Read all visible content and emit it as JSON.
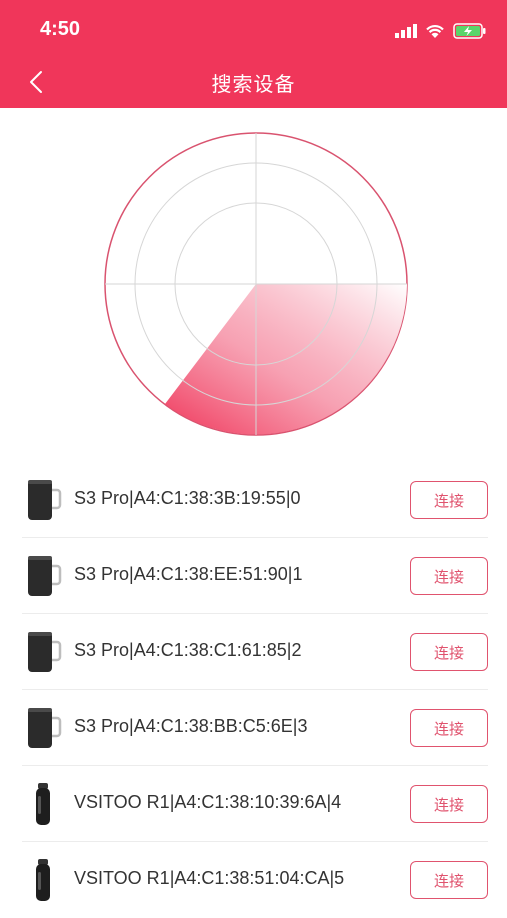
{
  "status_bar": {
    "time": "4:50"
  },
  "nav": {
    "title": "搜索设备"
  },
  "colors": {
    "accent": "#f0365a",
    "button_border": "#e0536e"
  },
  "devices": [
    {
      "name": "S3 Pro|A4:C1:38:3B:19:55|0",
      "icon": "mug-icon",
      "action": "连接"
    },
    {
      "name": "S3 Pro|A4:C1:38:EE:51:90|1",
      "icon": "mug-icon",
      "action": "连接"
    },
    {
      "name": "S3 Pro|A4:C1:38:C1:61:85|2",
      "icon": "mug-icon",
      "action": "连接"
    },
    {
      "name": "S3 Pro|A4:C1:38:BB:C5:6E|3",
      "icon": "mug-icon",
      "action": "连接"
    },
    {
      "name": "VSITOO R1|A4:C1:38:10:39:6A|4",
      "icon": "bottle-icon",
      "action": "连接"
    },
    {
      "name": "VSITOO R1|A4:C1:38:51:04:CA|5",
      "icon": "bottle-icon",
      "action": "连接"
    }
  ]
}
